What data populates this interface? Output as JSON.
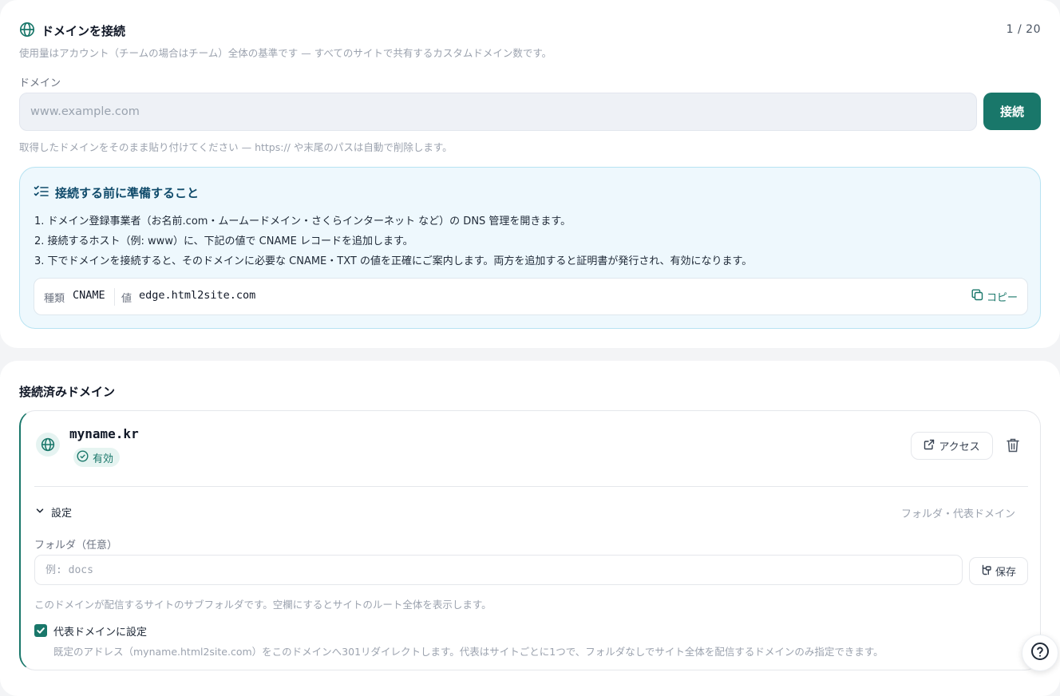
{
  "connect": {
    "title": "ドメインを接続",
    "usage": "1 / 20",
    "subtitle": "使用量はアカウント（チームの場合はチーム）全体の基準です — すべてのサイトで共有するカスタムドメイン数です。",
    "field_label": "ドメイン",
    "placeholder": "www.example.com",
    "connect_label": "接続",
    "hint": "取得したドメインをそのまま貼り付けてください — https:// や末尾のパスは自動で削除します。"
  },
  "prep": {
    "title": "接続する前に準備すること",
    "steps": [
      "1. ドメイン登録事業者（お名前.com・ムームードメイン・さくらインターネット など）の DNS 管理を開きます。",
      "2. 接続するホスト（例: www）に、下記の値で CNAME レコードを追加します。",
      "3. 下でドメインを接続すると、そのドメインに必要な CNAME・TXT の値を正確にご案内します。両方を追加すると証明書が発行され、有効になります。"
    ],
    "record": {
      "type_key": "種類",
      "type_value": "CNAME",
      "value_key": "値",
      "value": "edge.html2site.com",
      "copy_label": "コピー"
    }
  },
  "connected": {
    "title": "接続済みドメイン",
    "domain": {
      "name": "myname.kr",
      "status": "有効",
      "access_label": "アクセス",
      "settings_label": "設定",
      "settings_hint": "フォルダ・代表ドメイン",
      "folder_label": "フォルダ（任意）",
      "folder_placeholder": "例: docs",
      "save_label": "保存",
      "folder_help": "このドメインが配信するサイトのサブフォルダです。空欄にするとサイトのルート全体を表示します。",
      "primary_label": "代表ドメインに設定",
      "primary_checked": true,
      "primary_help": "既定のアドレス（myname.html2site.com）をこのドメインへ301リダイレクトします。代表はサイトごとに1つで、フォルダなしでサイト全体を配信するドメインのみ指定できます。"
    }
  },
  "colors": {
    "accent": "#19776a",
    "info_bg": "#eef8fd",
    "info_border": "#b7e3f2",
    "muted_text": "#9ca3af"
  },
  "icons": [
    "globe-icon",
    "checklist-icon",
    "copy-icon",
    "check-circle-icon",
    "external-link-icon",
    "trash-icon",
    "chevron-down-icon",
    "save-icon",
    "checkmark-icon",
    "help-icon"
  ]
}
